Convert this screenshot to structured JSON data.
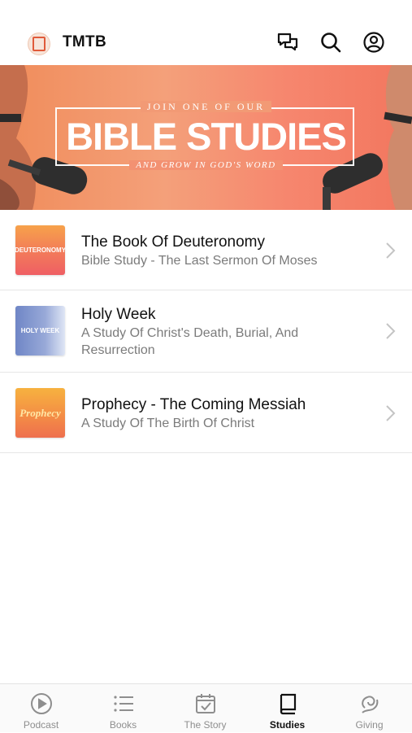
{
  "header": {
    "title": "TMTB",
    "icons": [
      "logo-icon",
      "chat-icon",
      "search-icon",
      "account-icon"
    ]
  },
  "banner": {
    "top_line": "JOIN ONE OF OUR",
    "main": "BIBLE STUDIES",
    "bottom_line": "AND GROW IN GOD'S WORD",
    "colors": {
      "start": "#f08c5a",
      "end": "#f2765e"
    }
  },
  "studies": [
    {
      "thumb_text": "DEUTERONOMY",
      "title": "The Book Of Deuteronomy",
      "subtitle": "Bible Study - The Last Sermon Of Moses"
    },
    {
      "thumb_text": "HOLY WEEK",
      "title": "Holy Week",
      "subtitle": "A Study Of Christ's Death, Burial, And Resurrection"
    },
    {
      "thumb_text": "Prophecy",
      "title": "Prophecy - The Coming Messiah",
      "subtitle": "A Study Of The Birth Of Christ"
    }
  ],
  "tabs": [
    {
      "label": "Podcast",
      "icon": "play-circle-icon"
    },
    {
      "label": "Books",
      "icon": "list-icon"
    },
    {
      "label": "The Story",
      "icon": "calendar-check-icon"
    },
    {
      "label": "Studies",
      "icon": "book-icon",
      "active": true
    },
    {
      "label": "Giving",
      "icon": "giving-icon"
    }
  ],
  "colors": {
    "active_tab": "#111111",
    "inactive_tab": "#8e8e8e",
    "subtitle": "#7b7b7b"
  }
}
